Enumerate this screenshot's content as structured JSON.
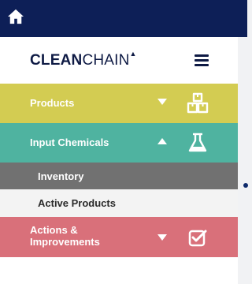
{
  "brand": {
    "bold": "CLEAN",
    "light": "CHAIN"
  },
  "nav": {
    "products": {
      "label": "Products",
      "color": "#d3cc52",
      "icon": "boxes-icon"
    },
    "input_chemicals": {
      "label": "Input Chemicals",
      "color": "#4fb3a0",
      "icon": "flask-icon"
    },
    "inventory": {
      "label": "Inventory",
      "active": true
    },
    "active_products": {
      "label": "Active Products"
    },
    "actions": {
      "label_line1": "Actions &",
      "label_line2": "Improvements",
      "color": "#d9707a",
      "icon": "checkbox-icon"
    }
  },
  "colors": {
    "topbar": "#0d1f57",
    "brand_text": "#0e1a44"
  }
}
